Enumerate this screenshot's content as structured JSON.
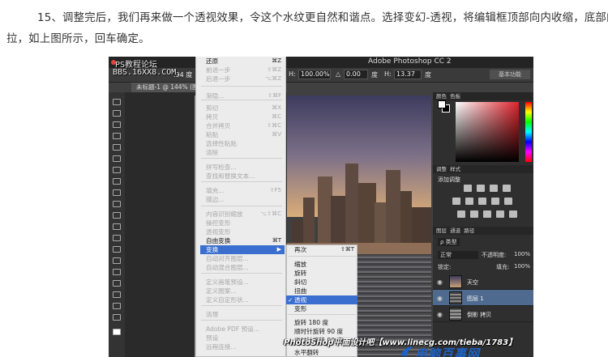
{
  "paragraph": {
    "line1": "15、调整完后，我们再来做一个透视效果，令这个水纹更自然和谐点。选择变幻-透视，将编辑框顶部向内收缩，底部向外",
    "line2": "拉，如上图所示，回车确定。"
  },
  "screenshot": {
    "watermark1": "PS教程论坛",
    "watermark2": "BBS.16XX8.COM",
    "app_title": "Adobe Photoshop CC 2",
    "options": {
      "h_label": "H:",
      "h_value": "100.00%",
      "angle": "0.00",
      "deg1": "度",
      "h2_label": "H:",
      "h2_value": "13.37",
      "deg2": "度",
      "essentials": "基本功能"
    },
    "doc_tab": "未标题-1 @ 144% (图",
    "zoom_fragment": ".94 度",
    "edit_menu": {
      "items": [
        {
          "label": "还原",
          "shortcut": "⌘Z",
          "disabled": false
        },
        {
          "label": "前进一步",
          "shortcut": "⇧⌘Z",
          "disabled": true
        },
        {
          "label": "后退一步",
          "shortcut": "⌥⌘Z",
          "disabled": true
        },
        {
          "label": "渐隐...",
          "shortcut": "⇧⌘F",
          "disabled": true
        },
        {
          "label": "剪切",
          "shortcut": "⌘X",
          "disabled": true
        },
        {
          "label": "拷贝",
          "shortcut": "⌘C",
          "disabled": true
        },
        {
          "label": "合并拷贝",
          "shortcut": "⇧⌘C",
          "disabled": true
        },
        {
          "label": "粘贴",
          "shortcut": "⌘V",
          "disabled": true
        },
        {
          "label": "选择性粘贴",
          "shortcut": "",
          "disabled": true
        },
        {
          "label": "清除",
          "shortcut": "",
          "disabled": true
        },
        {
          "label": "拼写检查...",
          "shortcut": "",
          "disabled": true
        },
        {
          "label": "查找和替换文本...",
          "shortcut": "",
          "disabled": true
        },
        {
          "label": "填充...",
          "shortcut": "⇧F5",
          "disabled": true
        },
        {
          "label": "描边...",
          "shortcut": "",
          "disabled": true
        },
        {
          "label": "内容识别缩放",
          "shortcut": "⌥⇧⌘C",
          "disabled": true
        },
        {
          "label": "操控变形",
          "shortcut": "",
          "disabled": true
        },
        {
          "label": "透视变形",
          "shortcut": "",
          "disabled": true
        },
        {
          "label": "自由变换",
          "shortcut": "⌘T",
          "disabled": false
        },
        {
          "label": "变换",
          "shortcut": "",
          "disabled": false,
          "highlighted": true
        },
        {
          "label": "自动对齐图层...",
          "shortcut": "",
          "disabled": true
        },
        {
          "label": "自动混合图层...",
          "shortcut": "",
          "disabled": true
        },
        {
          "label": "定义画笔预设...",
          "shortcut": "",
          "disabled": true
        },
        {
          "label": "定义图案...",
          "shortcut": "",
          "disabled": true
        },
        {
          "label": "定义自定形状...",
          "shortcut": "",
          "disabled": true
        },
        {
          "label": "清理",
          "shortcut": "",
          "disabled": true
        },
        {
          "label": "Adobe PDF 预设...",
          "shortcut": "",
          "disabled": true
        },
        {
          "label": "预设",
          "shortcut": "",
          "disabled": true
        },
        {
          "label": "远程连接...",
          "shortcut": "",
          "disabled": true
        }
      ]
    },
    "transform_submenu": {
      "items": [
        {
          "label": "再次",
          "shortcut": "⇧⌘T"
        },
        {
          "label": "缩放",
          "shortcut": ""
        },
        {
          "label": "旋转",
          "shortcut": ""
        },
        {
          "label": "斜切",
          "shortcut": ""
        },
        {
          "label": "扭曲",
          "shortcut": ""
        },
        {
          "label": "透视",
          "shortcut": "",
          "checked": true,
          "highlighted": true
        },
        {
          "label": "变形",
          "shortcut": ""
        },
        {
          "label": "旋转 180 度",
          "shortcut": ""
        },
        {
          "label": "顺时针旋转 90 度",
          "shortcut": ""
        },
        {
          "label": "逆时针旋转 90 度",
          "shortcut": ""
        },
        {
          "label": "水平翻转",
          "shortcut": ""
        }
      ],
      "check_mark": "✓"
    },
    "panels": {
      "color_tab": "颜色",
      "swatch_tab": "色板",
      "adjust_tab": "调整",
      "style_tab": "样式",
      "add_adjust": "添加调整",
      "layers_tab": "图层",
      "channels_tab": "通道",
      "paths_tab": "路径",
      "kind": "ρ 类型",
      "blend": "正常",
      "opacity_label": "不透明度:",
      "opacity": "100%",
      "lock_label": "锁定:",
      "fill_label": "填充:",
      "fill": "100%",
      "layers": [
        {
          "name": "天空",
          "selected": false
        },
        {
          "name": "图层 1",
          "selected": true
        },
        {
          "name": "倒影 拷贝",
          "selected": false
        }
      ]
    },
    "bottom_watermark": "PhotoShop平面设计吧【www.linecg.com/tieba/1783】",
    "site_logo": "电脑百事网"
  },
  "colors": {
    "menu_highlight": "#3a6fcf",
    "logo_blue": "#1d63c8"
  }
}
